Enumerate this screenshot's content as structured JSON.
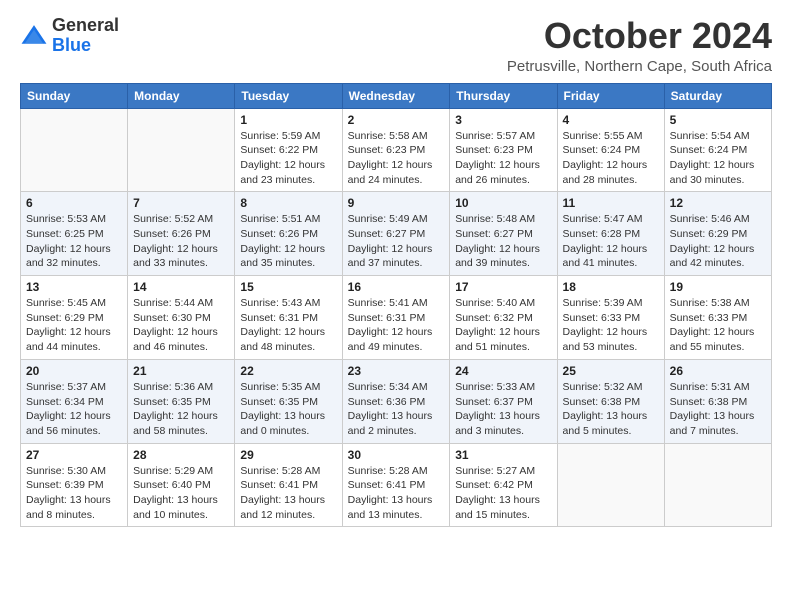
{
  "logo": {
    "text_general": "General",
    "text_blue": "Blue"
  },
  "title": "October 2024",
  "location": "Petrusville, Northern Cape, South Africa",
  "headers": [
    "Sunday",
    "Monday",
    "Tuesday",
    "Wednesday",
    "Thursday",
    "Friday",
    "Saturday"
  ],
  "weeks": [
    [
      {
        "day": "",
        "info": ""
      },
      {
        "day": "",
        "info": ""
      },
      {
        "day": "1",
        "info": "Sunrise: 5:59 AM\nSunset: 6:22 PM\nDaylight: 12 hours and 23 minutes."
      },
      {
        "day": "2",
        "info": "Sunrise: 5:58 AM\nSunset: 6:23 PM\nDaylight: 12 hours and 24 minutes."
      },
      {
        "day": "3",
        "info": "Sunrise: 5:57 AM\nSunset: 6:23 PM\nDaylight: 12 hours and 26 minutes."
      },
      {
        "day": "4",
        "info": "Sunrise: 5:55 AM\nSunset: 6:24 PM\nDaylight: 12 hours and 28 minutes."
      },
      {
        "day": "5",
        "info": "Sunrise: 5:54 AM\nSunset: 6:24 PM\nDaylight: 12 hours and 30 minutes."
      }
    ],
    [
      {
        "day": "6",
        "info": "Sunrise: 5:53 AM\nSunset: 6:25 PM\nDaylight: 12 hours and 32 minutes."
      },
      {
        "day": "7",
        "info": "Sunrise: 5:52 AM\nSunset: 6:26 PM\nDaylight: 12 hours and 33 minutes."
      },
      {
        "day": "8",
        "info": "Sunrise: 5:51 AM\nSunset: 6:26 PM\nDaylight: 12 hours and 35 minutes."
      },
      {
        "day": "9",
        "info": "Sunrise: 5:49 AM\nSunset: 6:27 PM\nDaylight: 12 hours and 37 minutes."
      },
      {
        "day": "10",
        "info": "Sunrise: 5:48 AM\nSunset: 6:27 PM\nDaylight: 12 hours and 39 minutes."
      },
      {
        "day": "11",
        "info": "Sunrise: 5:47 AM\nSunset: 6:28 PM\nDaylight: 12 hours and 41 minutes."
      },
      {
        "day": "12",
        "info": "Sunrise: 5:46 AM\nSunset: 6:29 PM\nDaylight: 12 hours and 42 minutes."
      }
    ],
    [
      {
        "day": "13",
        "info": "Sunrise: 5:45 AM\nSunset: 6:29 PM\nDaylight: 12 hours and 44 minutes."
      },
      {
        "day": "14",
        "info": "Sunrise: 5:44 AM\nSunset: 6:30 PM\nDaylight: 12 hours and 46 minutes."
      },
      {
        "day": "15",
        "info": "Sunrise: 5:43 AM\nSunset: 6:31 PM\nDaylight: 12 hours and 48 minutes."
      },
      {
        "day": "16",
        "info": "Sunrise: 5:41 AM\nSunset: 6:31 PM\nDaylight: 12 hours and 49 minutes."
      },
      {
        "day": "17",
        "info": "Sunrise: 5:40 AM\nSunset: 6:32 PM\nDaylight: 12 hours and 51 minutes."
      },
      {
        "day": "18",
        "info": "Sunrise: 5:39 AM\nSunset: 6:33 PM\nDaylight: 12 hours and 53 minutes."
      },
      {
        "day": "19",
        "info": "Sunrise: 5:38 AM\nSunset: 6:33 PM\nDaylight: 12 hours and 55 minutes."
      }
    ],
    [
      {
        "day": "20",
        "info": "Sunrise: 5:37 AM\nSunset: 6:34 PM\nDaylight: 12 hours and 56 minutes."
      },
      {
        "day": "21",
        "info": "Sunrise: 5:36 AM\nSunset: 6:35 PM\nDaylight: 12 hours and 58 minutes."
      },
      {
        "day": "22",
        "info": "Sunrise: 5:35 AM\nSunset: 6:35 PM\nDaylight: 13 hours and 0 minutes."
      },
      {
        "day": "23",
        "info": "Sunrise: 5:34 AM\nSunset: 6:36 PM\nDaylight: 13 hours and 2 minutes."
      },
      {
        "day": "24",
        "info": "Sunrise: 5:33 AM\nSunset: 6:37 PM\nDaylight: 13 hours and 3 minutes."
      },
      {
        "day": "25",
        "info": "Sunrise: 5:32 AM\nSunset: 6:38 PM\nDaylight: 13 hours and 5 minutes."
      },
      {
        "day": "26",
        "info": "Sunrise: 5:31 AM\nSunset: 6:38 PM\nDaylight: 13 hours and 7 minutes."
      }
    ],
    [
      {
        "day": "27",
        "info": "Sunrise: 5:30 AM\nSunset: 6:39 PM\nDaylight: 13 hours and 8 minutes."
      },
      {
        "day": "28",
        "info": "Sunrise: 5:29 AM\nSunset: 6:40 PM\nDaylight: 13 hours and 10 minutes."
      },
      {
        "day": "29",
        "info": "Sunrise: 5:28 AM\nSunset: 6:41 PM\nDaylight: 13 hours and 12 minutes."
      },
      {
        "day": "30",
        "info": "Sunrise: 5:28 AM\nSunset: 6:41 PM\nDaylight: 13 hours and 13 minutes."
      },
      {
        "day": "31",
        "info": "Sunrise: 5:27 AM\nSunset: 6:42 PM\nDaylight: 13 hours and 15 minutes."
      },
      {
        "day": "",
        "info": ""
      },
      {
        "day": "",
        "info": ""
      }
    ]
  ]
}
